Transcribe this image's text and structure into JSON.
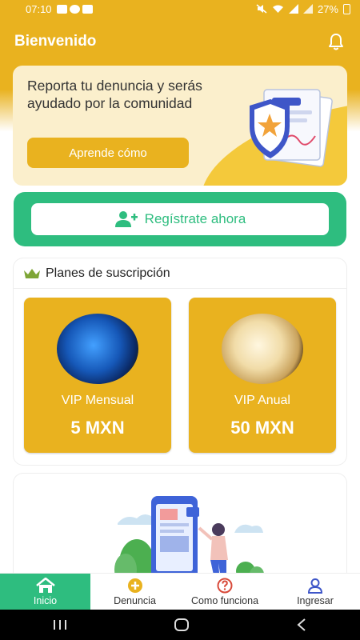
{
  "status_bar": {
    "time": "07:10",
    "battery": "27%"
  },
  "header": {
    "title": "Bienvenido"
  },
  "hero": {
    "text": "Reporta tu denuncia y serás ayudado por la comunidad",
    "button_label": "Aprende cómo"
  },
  "register": {
    "button_label": "Regístrate ahora"
  },
  "plans": {
    "title": "Planes de  suscripción",
    "items": [
      {
        "name": "VIP Mensual",
        "price": "5 MXN"
      },
      {
        "name": "VIP Anual",
        "price": "50 MXN"
      }
    ]
  },
  "bottom_nav": {
    "items": [
      {
        "label": "Inicio",
        "icon": "home-icon",
        "active": true
      },
      {
        "label": "Denuncia",
        "icon": "add-circle-icon",
        "active": false
      },
      {
        "label": "Como funciona",
        "icon": "help-icon",
        "active": false
      },
      {
        "label": "Ingresar",
        "icon": "user-icon",
        "active": false
      }
    ]
  },
  "colors": {
    "primary_yellow": "#e9b21f",
    "accent_green": "#2ebd7f",
    "hero_bg": "#fbefcc"
  }
}
